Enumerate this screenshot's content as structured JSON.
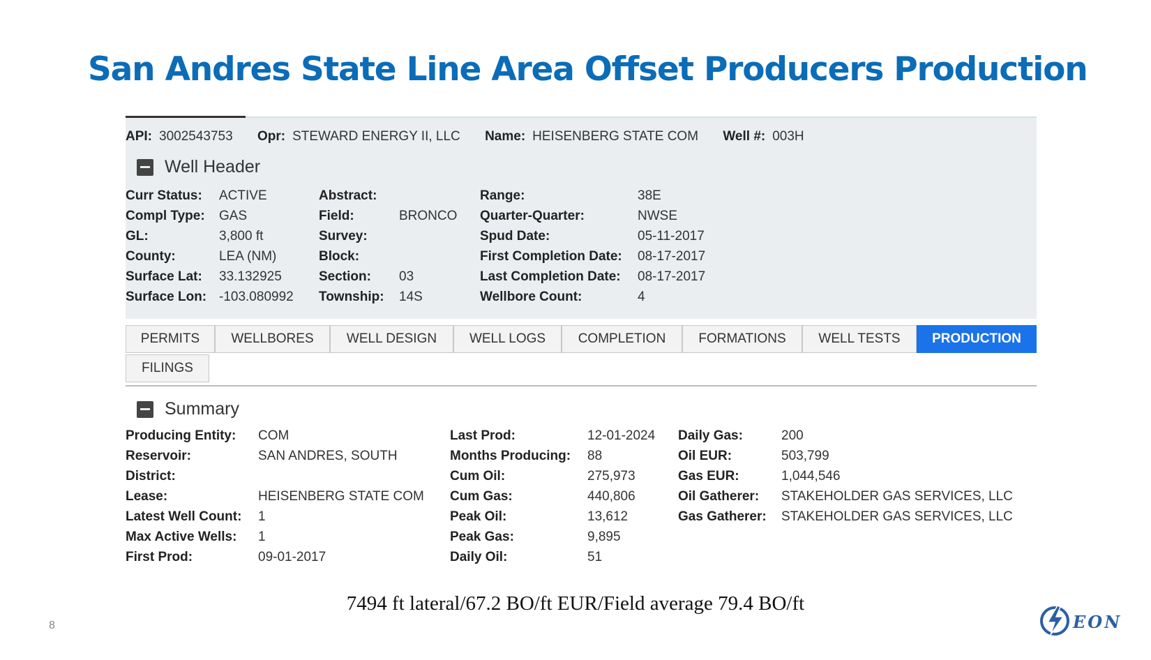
{
  "slide": {
    "title": "San Andres State Line Area Offset Producers Production",
    "caption": "7494 ft lateral/67.2 BO/ft EUR/Field average 79.4 BO/ft",
    "page_number": "8",
    "logo_text": "EON"
  },
  "well_id": {
    "api_label": "API:",
    "api_value": "3002543753",
    "opr_label": "Opr:",
    "opr_value": "STEWARD ENERGY II, LLC",
    "name_label": "Name:",
    "name_value": "HEISENBERG STATE COM",
    "wellno_label": "Well #:",
    "wellno_value": "003H"
  },
  "well_header": {
    "title": "Well Header",
    "fields": [
      {
        "label": "Curr Status:",
        "value": "ACTIVE"
      },
      {
        "label": "Compl Type:",
        "value": "GAS"
      },
      {
        "label": "GL:",
        "value": "3,800 ft"
      },
      {
        "label": "County:",
        "value": "LEA (NM)"
      },
      {
        "label": "Surface Lat:",
        "value": "33.132925"
      },
      {
        "label": "Surface Lon:",
        "value": "-103.080992"
      },
      {
        "label": "Abstract:",
        "value": ""
      },
      {
        "label": "Field:",
        "value": "BRONCO"
      },
      {
        "label": "Survey:",
        "value": ""
      },
      {
        "label": "Block:",
        "value": ""
      },
      {
        "label": "Section:",
        "value": "03"
      },
      {
        "label": "Township:",
        "value": "14S"
      },
      {
        "label": "Range:",
        "value": "38E"
      },
      {
        "label": "Quarter-Quarter:",
        "value": "NWSE"
      },
      {
        "label": "Spud Date:",
        "value": "05-11-2017"
      },
      {
        "label": "First Completion Date:",
        "value": "08-17-2017"
      },
      {
        "label": "Last Completion Date:",
        "value": "08-17-2017"
      },
      {
        "label": "Wellbore Count:",
        "value": "4"
      }
    ]
  },
  "tabs": [
    {
      "label": "PERMITS",
      "active": false
    },
    {
      "label": "WELLBORES",
      "active": false
    },
    {
      "label": "WELL DESIGN",
      "active": false
    },
    {
      "label": "WELL LOGS",
      "active": false
    },
    {
      "label": "COMPLETION",
      "active": false
    },
    {
      "label": "FORMATIONS",
      "active": false
    },
    {
      "label": "WELL TESTS",
      "active": false
    },
    {
      "label": "PRODUCTION",
      "active": true
    },
    {
      "label": "FILINGS",
      "active": false
    }
  ],
  "summary": {
    "title": "Summary",
    "fields": [
      {
        "label": "Producing Entity:",
        "value": "COM"
      },
      {
        "label": "Reservoir:",
        "value": "SAN ANDRES, SOUTH"
      },
      {
        "label": "District:",
        "value": ""
      },
      {
        "label": "Lease:",
        "value": "HEISENBERG STATE COM"
      },
      {
        "label": "Latest Well Count:",
        "value": "1"
      },
      {
        "label": "Max Active Wells:",
        "value": "1"
      },
      {
        "label": "First Prod:",
        "value": "09-01-2017"
      },
      {
        "label": "Last Prod:",
        "value": "12-01-2024"
      },
      {
        "label": "Months Producing:",
        "value": "88"
      },
      {
        "label": "Cum Oil:",
        "value": "275,973"
      },
      {
        "label": "Cum Gas:",
        "value": "440,806"
      },
      {
        "label": "Peak Oil:",
        "value": "13,612"
      },
      {
        "label": "Peak Gas:",
        "value": "9,895"
      },
      {
        "label": "Daily Oil:",
        "value": "51"
      },
      {
        "label": "Daily Gas:",
        "value": "200"
      },
      {
        "label": "Oil EUR:",
        "value": "503,799"
      },
      {
        "label": "Gas EUR:",
        "value": "1,044,546"
      },
      {
        "label": "Oil Gatherer:",
        "value": "STAKEHOLDER GAS SERVICES, LLC"
      },
      {
        "label": "Gas Gatherer:",
        "value": "STAKEHOLDER GAS SERVICES, LLC"
      }
    ]
  },
  "colors": {
    "title_blue": "#0b6cb8",
    "active_tab": "#1a73e8",
    "panel_bg": "#eaeef1"
  }
}
